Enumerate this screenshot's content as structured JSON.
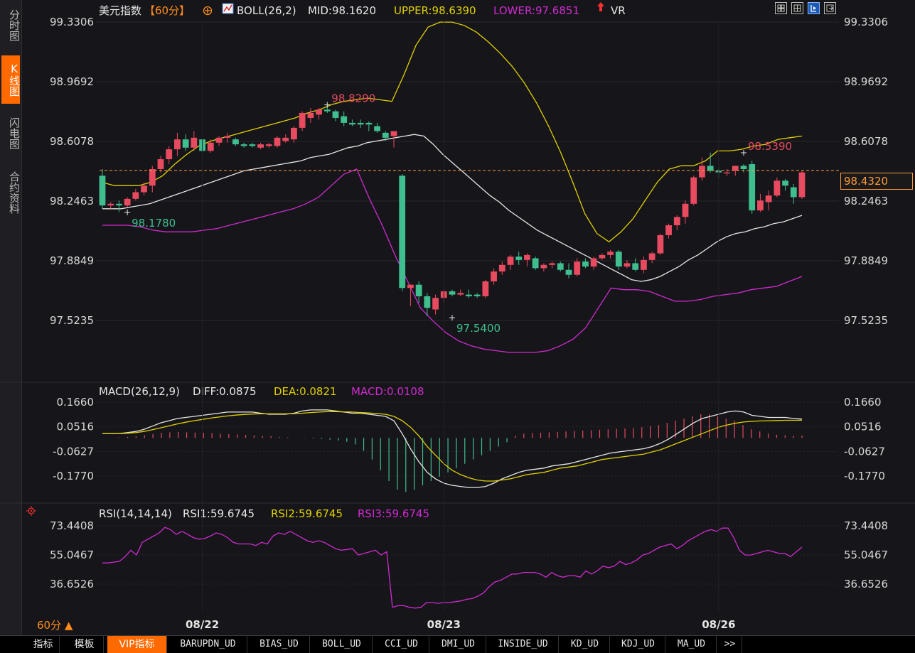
{
  "sidebar": {
    "tabs": [
      {
        "label": "分时图",
        "active": false
      },
      {
        "label": "K线图",
        "active": true
      },
      {
        "label": "闪电图",
        "active": false
      },
      {
        "label": "合约资料",
        "active": false
      }
    ]
  },
  "header": {
    "instrument": "美元指数",
    "period": "【60分】",
    "indicator": "BOLL(26,2)",
    "mid": "MID:98.1620",
    "upper": "UPPER:98.6390",
    "lower": "LOWER:97.6851",
    "vr": "VR"
  },
  "last_price": "98.4320",
  "period_selector": "60分",
  "colors": {
    "up": "#e84a5f",
    "down": "#3fbf8f",
    "mid": "#e6e6e6",
    "upper": "#e0d000",
    "lower": "#d02ad0",
    "rsi": "#d02ad0",
    "accent": "#ff6a00"
  },
  "chart_data": [
    {
      "type": "candlestick",
      "panel": "main",
      "y_ticks": [
        "99.3306",
        "98.9692",
        "98.6078",
        "98.2463",
        "97.8849",
        "97.5235"
      ],
      "y_tick_values": [
        99.3306,
        98.9692,
        98.6078,
        98.2463,
        97.8849,
        97.5235
      ],
      "x_labels": [
        {
          "label": "08/22",
          "index": 12
        },
        {
          "label": "08/23",
          "index": 41
        },
        {
          "label": "08/26",
          "index": 74
        }
      ],
      "annotations": [
        {
          "text": "98.8290",
          "value": 98.829,
          "index": 27
        },
        {
          "text": "98.1780",
          "value": 98.178,
          "index": 3
        },
        {
          "text": "97.5400",
          "value": 97.54,
          "index": 42
        },
        {
          "text": "98.5390",
          "value": 98.539,
          "index": 77
        }
      ],
      "candles": [
        [
          98.4,
          98.44,
          98.2,
          98.22
        ],
        [
          98.22,
          98.24,
          98.2,
          98.23
        ],
        [
          98.23,
          98.25,
          98.18,
          98.22
        ],
        [
          98.22,
          98.27,
          98.21,
          98.26
        ],
        [
          98.26,
          98.32,
          98.25,
          98.3
        ],
        [
          98.3,
          98.36,
          98.28,
          98.34
        ],
        [
          98.34,
          98.46,
          98.3,
          98.44
        ],
        [
          98.44,
          98.52,
          98.42,
          98.5
        ],
        [
          98.5,
          98.58,
          98.47,
          98.56
        ],
        [
          98.56,
          98.66,
          98.52,
          98.62
        ],
        [
          98.62,
          98.65,
          98.55,
          98.57
        ],
        [
          98.57,
          98.67,
          98.55,
          98.63
        ],
        [
          98.62,
          98.63,
          98.54,
          98.55
        ],
        [
          98.55,
          98.62,
          98.54,
          98.6
        ],
        [
          98.6,
          98.64,
          98.58,
          98.63
        ],
        [
          98.63,
          98.66,
          98.6,
          98.64
        ],
        [
          98.62,
          98.63,
          98.58,
          98.59
        ],
        [
          98.59,
          98.6,
          98.57,
          98.58
        ],
        [
          98.59,
          98.6,
          98.57,
          98.58
        ],
        [
          98.57,
          98.6,
          98.56,
          98.59
        ],
        [
          98.58,
          98.6,
          98.57,
          98.59
        ],
        [
          98.58,
          98.64,
          98.57,
          98.63
        ],
        [
          98.61,
          98.65,
          98.6,
          98.63
        ],
        [
          98.62,
          98.7,
          98.6,
          98.69
        ],
        [
          98.69,
          98.79,
          98.67,
          98.78
        ],
        [
          98.75,
          98.81,
          98.72,
          98.78
        ],
        [
          98.77,
          98.81,
          98.74,
          98.8
        ],
        [
          98.8,
          98.83,
          98.78,
          98.79
        ],
        [
          98.79,
          98.8,
          98.73,
          98.75
        ],
        [
          98.76,
          98.79,
          98.7,
          98.72
        ],
        [
          98.72,
          98.74,
          98.7,
          98.71
        ],
        [
          98.72,
          98.74,
          98.69,
          98.71
        ],
        [
          98.72,
          98.73,
          98.67,
          98.71
        ],
        [
          98.7,
          98.72,
          98.66,
          98.67
        ],
        [
          98.66,
          98.67,
          98.61,
          98.63
        ],
        [
          98.64,
          98.67,
          98.57,
          98.67
        ],
        [
          98.4,
          98.41,
          97.7,
          97.72
        ],
        [
          97.72,
          97.74,
          97.61,
          97.74
        ],
        [
          97.74,
          97.76,
          97.63,
          97.67
        ],
        [
          97.67,
          97.69,
          97.55,
          97.6
        ],
        [
          97.59,
          97.68,
          97.56,
          97.66
        ],
        [
          97.66,
          97.71,
          97.63,
          97.7
        ],
        [
          97.7,
          97.71,
          97.67,
          97.68
        ],
        [
          97.68,
          97.71,
          97.67,
          97.69
        ],
        [
          97.68,
          97.71,
          97.66,
          97.67
        ],
        [
          97.68,
          97.69,
          97.66,
          97.67
        ],
        [
          97.67,
          97.77,
          97.66,
          97.76
        ],
        [
          97.76,
          97.84,
          97.74,
          97.82
        ],
        [
          97.82,
          97.88,
          97.8,
          97.86
        ],
        [
          97.86,
          97.92,
          97.83,
          97.91
        ],
        [
          97.91,
          97.94,
          97.86,
          97.89
        ],
        [
          97.89,
          97.93,
          97.85,
          97.92
        ],
        [
          97.9,
          97.91,
          97.83,
          97.84
        ],
        [
          97.84,
          97.87,
          97.82,
          97.86
        ],
        [
          97.86,
          97.88,
          97.84,
          97.87
        ],
        [
          97.87,
          97.88,
          97.82,
          97.83
        ],
        [
          97.83,
          97.87,
          97.78,
          97.8
        ],
        [
          97.8,
          97.9,
          97.79,
          97.88
        ],
        [
          97.88,
          97.9,
          97.84,
          97.85
        ],
        [
          97.85,
          97.91,
          97.83,
          97.9
        ],
        [
          97.9,
          97.93,
          97.89,
          97.92
        ],
        [
          97.92,
          97.95,
          97.9,
          97.94
        ],
        [
          97.94,
          97.95,
          97.83,
          97.85
        ],
        [
          97.85,
          97.89,
          97.84,
          97.87
        ],
        [
          97.87,
          97.9,
          97.82,
          97.83
        ],
        [
          97.83,
          97.91,
          97.81,
          97.89
        ],
        [
          97.89,
          97.94,
          97.87,
          97.93
        ],
        [
          97.93,
          98.05,
          97.92,
          98.04
        ],
        [
          98.04,
          98.11,
          98.02,
          98.1
        ],
        [
          98.1,
          98.16,
          98.07,
          98.15
        ],
        [
          98.15,
          98.25,
          98.11,
          98.23
        ],
        [
          98.23,
          98.4,
          98.22,
          98.39
        ],
        [
          98.39,
          98.51,
          98.37,
          98.46
        ],
        [
          98.46,
          98.54,
          98.42,
          98.43
        ],
        [
          98.43,
          98.45,
          98.39,
          98.42
        ],
        [
          98.42,
          98.44,
          98.4,
          98.42
        ],
        [
          98.43,
          98.46,
          98.4,
          98.46
        ],
        [
          98.46,
          98.47,
          98.42,
          98.44
        ],
        [
          98.47,
          98.49,
          98.17,
          98.19
        ],
        [
          98.19,
          98.29,
          98.18,
          98.25
        ],
        [
          98.24,
          98.31,
          98.19,
          98.28
        ],
        [
          98.28,
          98.39,
          98.27,
          98.37
        ],
        [
          98.37,
          98.38,
          98.31,
          98.34
        ],
        [
          98.33,
          98.35,
          98.23,
          98.27
        ],
        [
          98.27,
          98.43,
          98.26,
          98.42
        ]
      ],
      "boll_mid": [
        98.2,
        98.2,
        98.2,
        98.21,
        98.22,
        98.23,
        98.25,
        98.27,
        98.29,
        98.31,
        98.33,
        98.35,
        98.37,
        98.39,
        98.41,
        98.43,
        98.44,
        98.45,
        98.46,
        98.47,
        98.48,
        98.49,
        98.51,
        98.52,
        98.53,
        98.55,
        98.57,
        98.58,
        98.6,
        98.61,
        98.62,
        98.63,
        98.64,
        98.65,
        98.64,
        98.59,
        98.53,
        98.48,
        98.43,
        98.38,
        98.33,
        98.28,
        98.24,
        98.19,
        98.15,
        98.11,
        98.07,
        98.04,
        98.01,
        97.98,
        97.95,
        97.92,
        97.89,
        97.86,
        97.83,
        97.8,
        97.77,
        97.76,
        97.77,
        97.79,
        97.82,
        97.85,
        97.89,
        97.92,
        97.96,
        98.0,
        98.03,
        98.05,
        98.06,
        98.08,
        98.09,
        98.11,
        98.12,
        98.14,
        98.16
      ],
      "boll_upper": [
        98.36,
        98.34,
        98.34,
        98.34,
        98.36,
        98.4,
        98.47,
        98.53,
        98.58,
        98.61,
        98.63,
        98.65,
        98.67,
        98.69,
        98.71,
        98.73,
        98.75,
        98.78,
        98.8,
        98.83,
        98.85,
        98.86,
        98.87,
        98.86,
        98.85,
        99.01,
        99.19,
        99.3,
        99.33,
        99.33,
        99.31,
        99.27,
        99.21,
        99.14,
        99.06,
        98.96,
        98.84,
        98.7,
        98.54,
        98.36,
        98.17,
        98.05,
        98.0,
        98.06,
        98.14,
        98.25,
        98.36,
        98.44,
        98.46,
        98.46,
        98.49,
        98.55,
        98.55,
        98.56,
        98.58,
        98.59,
        98.62,
        98.63,
        98.64
      ],
      "boll_lower": [
        98.1,
        98.1,
        98.1,
        98.09,
        98.07,
        98.06,
        98.06,
        98.06,
        98.07,
        98.08,
        98.1,
        98.12,
        98.14,
        98.16,
        98.18,
        98.2,
        98.23,
        98.27,
        98.34,
        98.41,
        98.44,
        98.26,
        98.1,
        97.92,
        97.76,
        97.6,
        97.52,
        97.45,
        97.4,
        97.37,
        97.35,
        97.34,
        97.33,
        97.33,
        97.33,
        97.34,
        97.37,
        97.41,
        97.48,
        97.6,
        97.72,
        97.71,
        97.71,
        97.7,
        97.67,
        97.64,
        97.64,
        97.65,
        97.67,
        97.68,
        97.69,
        97.71,
        97.72,
        97.73,
        97.76,
        97.79
      ],
      "mid_value": 98.162,
      "upper_value": 98.639,
      "lower_value": 97.6851
    },
    {
      "type": "macd",
      "panel": "macd",
      "title": "MACD(26,12,9)",
      "diff_label": "DIFF:0.0875",
      "dea_label": "DEA:0.0821",
      "macd_label": "MACD:0.0108",
      "y_ticks": [
        "0.1660",
        "0.0516",
        "-0.0627",
        "-0.1770"
      ],
      "y_tick_values": [
        0.166,
        0.0516,
        -0.0627,
        -0.177
      ],
      "diff": [
        0.02,
        0.02,
        0.02,
        0.025,
        0.03,
        0.04,
        0.055,
        0.07,
        0.08,
        0.09,
        0.095,
        0.1,
        0.105,
        0.11,
        0.115,
        0.12,
        0.12,
        0.12,
        0.12,
        0.115,
        0.11,
        0.11,
        0.11,
        0.115,
        0.125,
        0.13,
        0.13,
        0.13,
        0.125,
        0.12,
        0.115,
        0.115,
        0.11,
        0.105,
        0.1,
        0.08,
        0.02,
        -0.05,
        -0.11,
        -0.16,
        -0.19,
        -0.21,
        -0.22,
        -0.225,
        -0.23,
        -0.23,
        -0.225,
        -0.21,
        -0.19,
        -0.175,
        -0.16,
        -0.15,
        -0.145,
        -0.14,
        -0.13,
        -0.125,
        -0.12,
        -0.11,
        -0.1,
        -0.09,
        -0.08,
        -0.07,
        -0.065,
        -0.06,
        -0.055,
        -0.05,
        -0.04,
        -0.025,
        -0.005,
        0.02,
        0.045,
        0.07,
        0.09,
        0.1,
        0.11,
        0.12,
        0.125,
        0.12,
        0.105,
        0.1,
        0.095,
        0.095,
        0.095,
        0.09,
        0.0875
      ],
      "dea": [
        0.02,
        0.02,
        0.02,
        0.022,
        0.025,
        0.03,
        0.038,
        0.047,
        0.056,
        0.065,
        0.073,
        0.08,
        0.086,
        0.092,
        0.097,
        0.102,
        0.106,
        0.109,
        0.111,
        0.112,
        0.112,
        0.112,
        0.112,
        0.113,
        0.115,
        0.118,
        0.12,
        0.122,
        0.122,
        0.121,
        0.12,
        0.118,
        0.116,
        0.113,
        0.11,
        0.1,
        0.08,
        0.05,
        0.01,
        -0.04,
        -0.08,
        -0.12,
        -0.15,
        -0.17,
        -0.185,
        -0.195,
        -0.2,
        -0.2,
        -0.195,
        -0.19,
        -0.18,
        -0.17,
        -0.165,
        -0.16,
        -0.15,
        -0.14,
        -0.135,
        -0.13,
        -0.12,
        -0.11,
        -0.1,
        -0.095,
        -0.09,
        -0.085,
        -0.08,
        -0.075,
        -0.065,
        -0.055,
        -0.04,
        -0.025,
        -0.01,
        0.005,
        0.02,
        0.035,
        0.05,
        0.06,
        0.068,
        0.074,
        0.077,
        0.079,
        0.08,
        0.081,
        0.082,
        0.082,
        0.0821
      ],
      "hist": [
        0,
        0,
        0.002,
        0.005,
        0.008,
        0.012,
        0.018,
        0.024,
        0.026,
        0.028,
        0.026,
        0.025,
        0.024,
        0.022,
        0.02,
        0.018,
        0.016,
        0.014,
        0.012,
        0.01,
        0.008,
        0.005,
        0.003,
        0.001,
        -0.001,
        -0.003,
        -0.005,
        -0.008,
        -0.012,
        -0.018,
        -0.03,
        -0.06,
        -0.1,
        -0.15,
        -0.2,
        -0.24,
        -0.25,
        -0.24,
        -0.22,
        -0.2,
        -0.18,
        -0.16,
        -0.14,
        -0.12,
        -0.1,
        -0.08,
        -0.06,
        -0.04,
        -0.02,
        0.01,
        0.02,
        0.022,
        0.024,
        0.026,
        0.028,
        0.03,
        0.032,
        0.034,
        0.036,
        0.038,
        0.04,
        0.042,
        0.044,
        0.046,
        0.05,
        0.055,
        0.06,
        0.07,
        0.08,
        0.09,
        0.1,
        0.11,
        0.11,
        0.1,
        0.09,
        0.08,
        0.06,
        0.04,
        0.03,
        0.02,
        0.015,
        0.012,
        0.01,
        0.0108
      ]
    },
    {
      "type": "line",
      "panel": "rsi",
      "title": "RSI(14,14,14)",
      "rsi1_label": "RSI1:59.6745",
      "rsi2_label": "RSI2:59.6745",
      "rsi3_label": "RSI3:59.6745",
      "y_ticks": [
        "73.4408",
        "55.0467",
        "36.6526"
      ],
      "y_tick_values": [
        73.4408,
        55.0467,
        36.6526
      ],
      "values": [
        50,
        50,
        50.5,
        51,
        54,
        58,
        55,
        63,
        65,
        67,
        69,
        72.5,
        71,
        68,
        70,
        68,
        66,
        65,
        65.5,
        67,
        69,
        68,
        66,
        63,
        62,
        62,
        62,
        61,
        63,
        62,
        67,
        69,
        68,
        70,
        68,
        66,
        64,
        63,
        64,
        63,
        61,
        59,
        58,
        58.5,
        59,
        55,
        56,
        57,
        58,
        55,
        57,
        22,
        23,
        23,
        22,
        21.5,
        22,
        25,
        25,
        24.5,
        25,
        25,
        25.5,
        26,
        27,
        27.5,
        29,
        31,
        35,
        38,
        39,
        41,
        43,
        43,
        44,
        44,
        44,
        43,
        41,
        44,
        42,
        41,
        42,
        42,
        41,
        45,
        43,
        45,
        48,
        47,
        48,
        51,
        49,
        50,
        52,
        55,
        56,
        58,
        60,
        61,
        62,
        59,
        61,
        64,
        66,
        68,
        70,
        71,
        70,
        72,
        72,
        66,
        58,
        55,
        55,
        56,
        57,
        58,
        57,
        56,
        56,
        54,
        57,
        60
      ],
      "ylim": [
        15,
        80
      ]
    }
  ],
  "bottom_tabs": [
    {
      "label": "指标",
      "active": false
    },
    {
      "label": "模板",
      "active": false
    },
    {
      "label": "VIP指标",
      "active": true
    },
    {
      "label": "BARUPDN_UD",
      "active": false
    },
    {
      "label": "BIAS_UD",
      "active": false
    },
    {
      "label": "BOLL_UD",
      "active": false
    },
    {
      "label": "CCI_UD",
      "active": false
    },
    {
      "label": "DMI_UD",
      "active": false
    },
    {
      "label": "INSIDE_UD",
      "active": false
    },
    {
      "label": "KD_UD",
      "active": false
    },
    {
      "label": "KDJ_UD",
      "active": false
    },
    {
      "label": "MA_UD",
      "active": false
    },
    {
      "label": ">>",
      "active": false
    }
  ]
}
